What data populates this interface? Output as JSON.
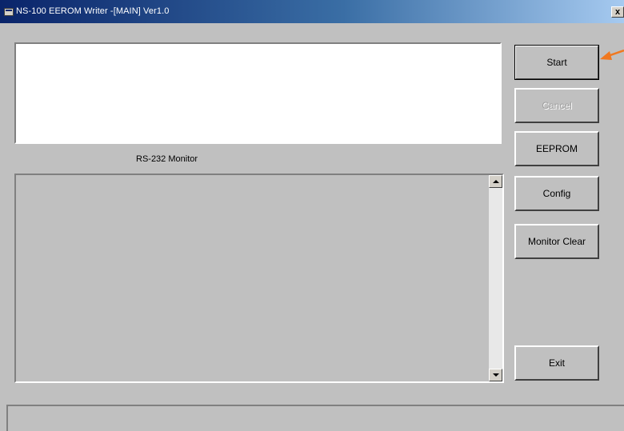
{
  "window": {
    "title": "NS-100 EEROM Writer -[MAIN]  Ver1.0",
    "close_label": "x"
  },
  "output_box": {
    "text": ""
  },
  "monitor": {
    "label": "RS-232 Monitor",
    "content": ""
  },
  "buttons": {
    "start": "Start",
    "cancel": "Cancel",
    "eeprom": "EEPROM",
    "config": "Config",
    "monitor_clear": "Monitor Clear",
    "exit": "Exit"
  },
  "status_bar": {
    "text": ""
  },
  "colors": {
    "face": "#c0c0c0",
    "title_start": "#0a246a",
    "title_end": "#a6caf0",
    "pointer_arrow": "#f07820"
  },
  "icons": [
    "app-icon",
    "close-icon",
    "scroll-up-icon",
    "scroll-down-icon",
    "arrow-pointer-icon"
  ]
}
